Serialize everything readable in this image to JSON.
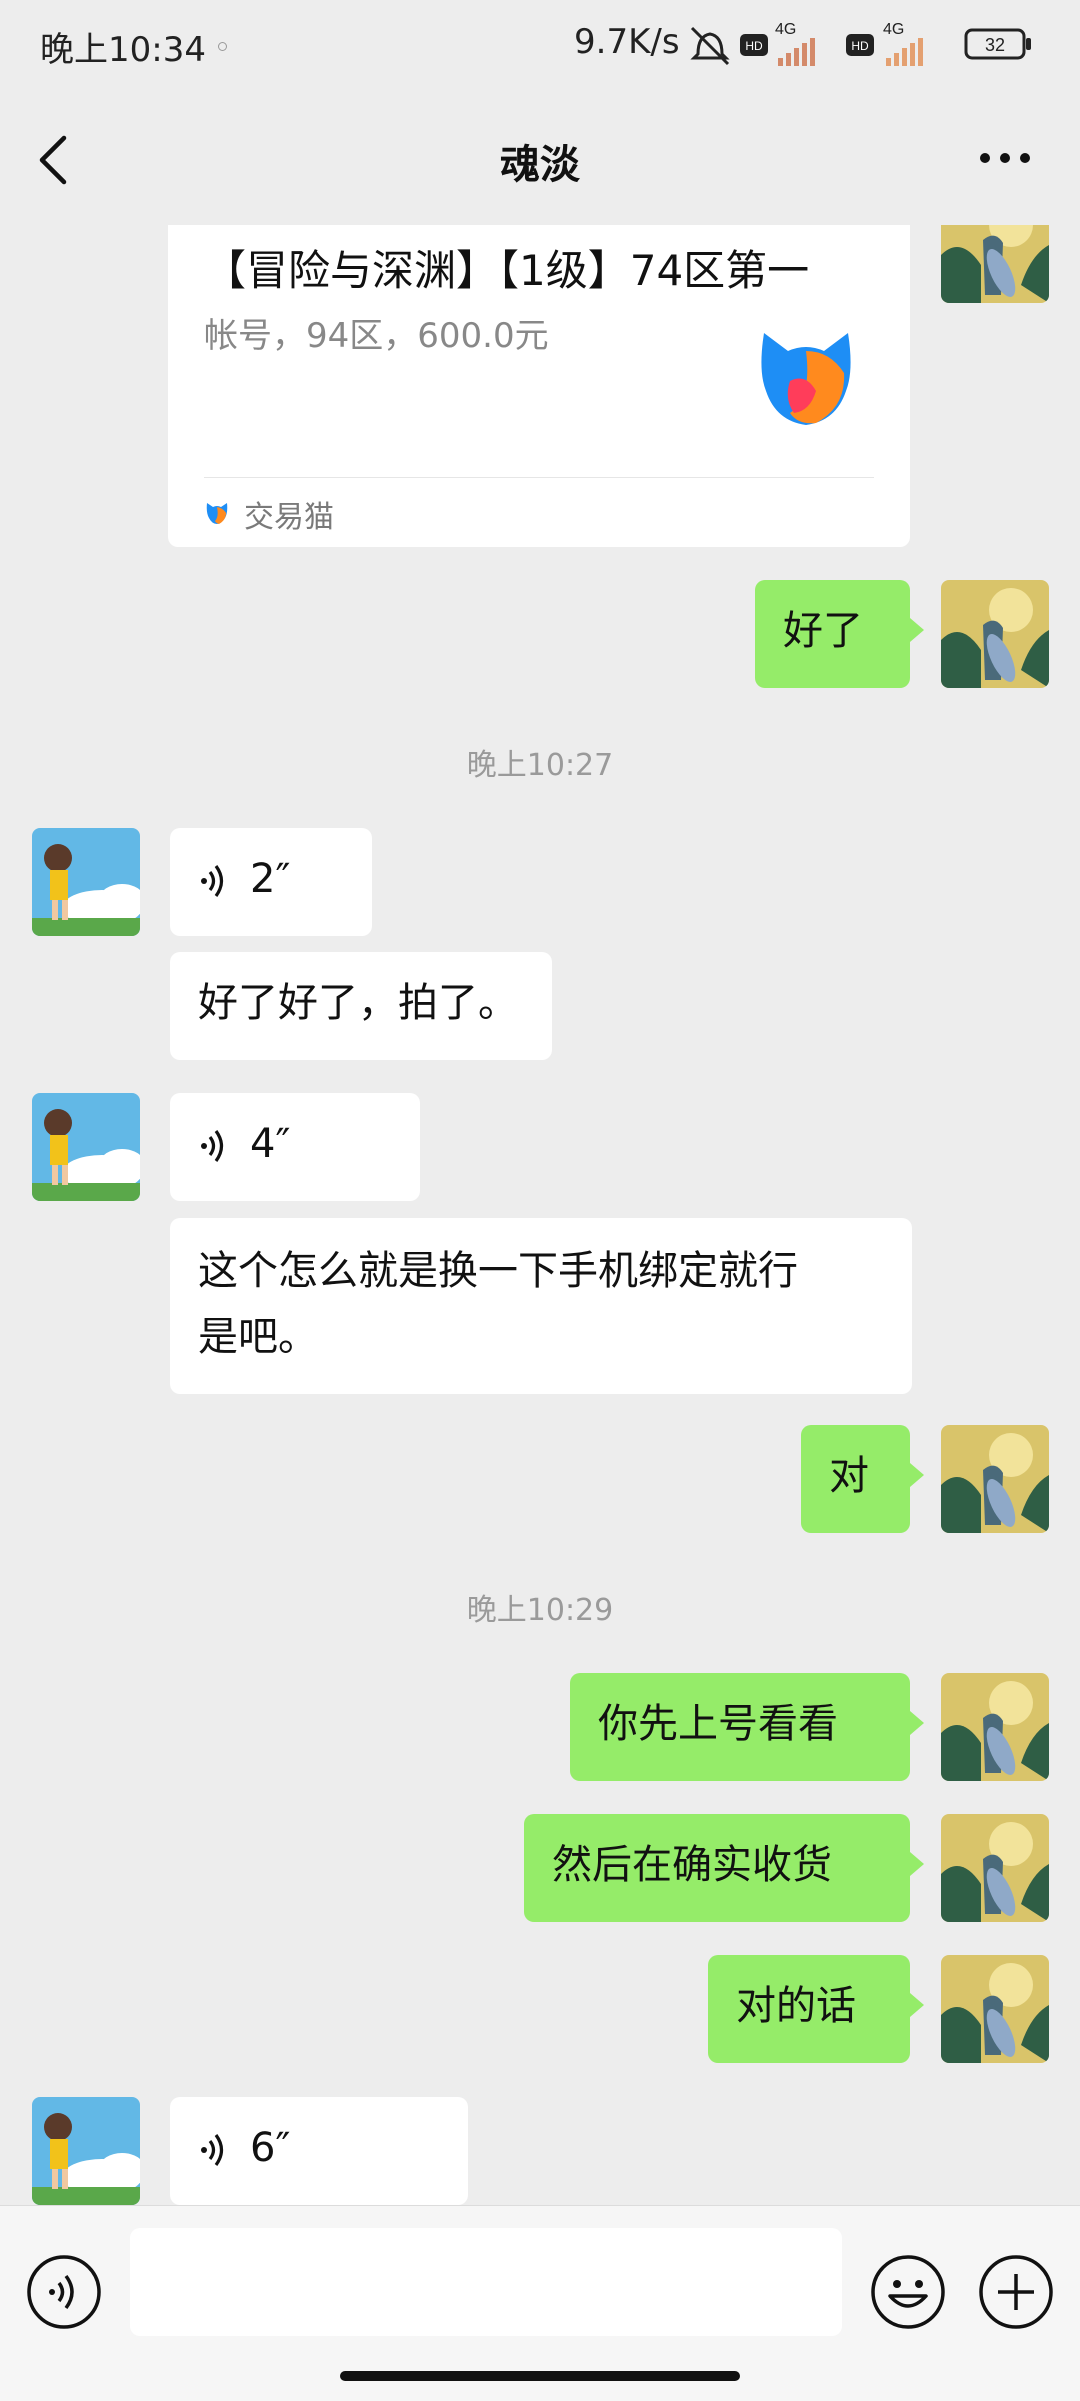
{
  "status_bar": {
    "time": "晚上10:34",
    "net_speed": "9.7K/s",
    "hd1": "HD",
    "net1": "4G",
    "hd2": "HD",
    "net2": "4G",
    "battery": "32"
  },
  "nav": {
    "title": "魂淡"
  },
  "card": {
    "title": "【冒险与深渊】【1级】74区第一",
    "desc": "帐号，94区，600.0元",
    "source": "交易猫"
  },
  "messages": {
    "m1": "好了",
    "ts1": "晚上10:27",
    "v1": "2″",
    "m2": "好了好了，拍了。",
    "v2": "4″",
    "m3_line1": "这个怎么就是换一下手机绑定就行",
    "m3_line2": "是吧。",
    "m4": "对",
    "ts2": "晚上10:29",
    "m5": "你先上号看看",
    "m6": "然后在确实收货",
    "m7": "对的话",
    "v3": "6″"
  },
  "input": {
    "placeholder": ""
  },
  "colors": {
    "outgoing_bubble": "#95ec69",
    "incoming_bubble": "#ffffff",
    "background": "#ededed"
  }
}
